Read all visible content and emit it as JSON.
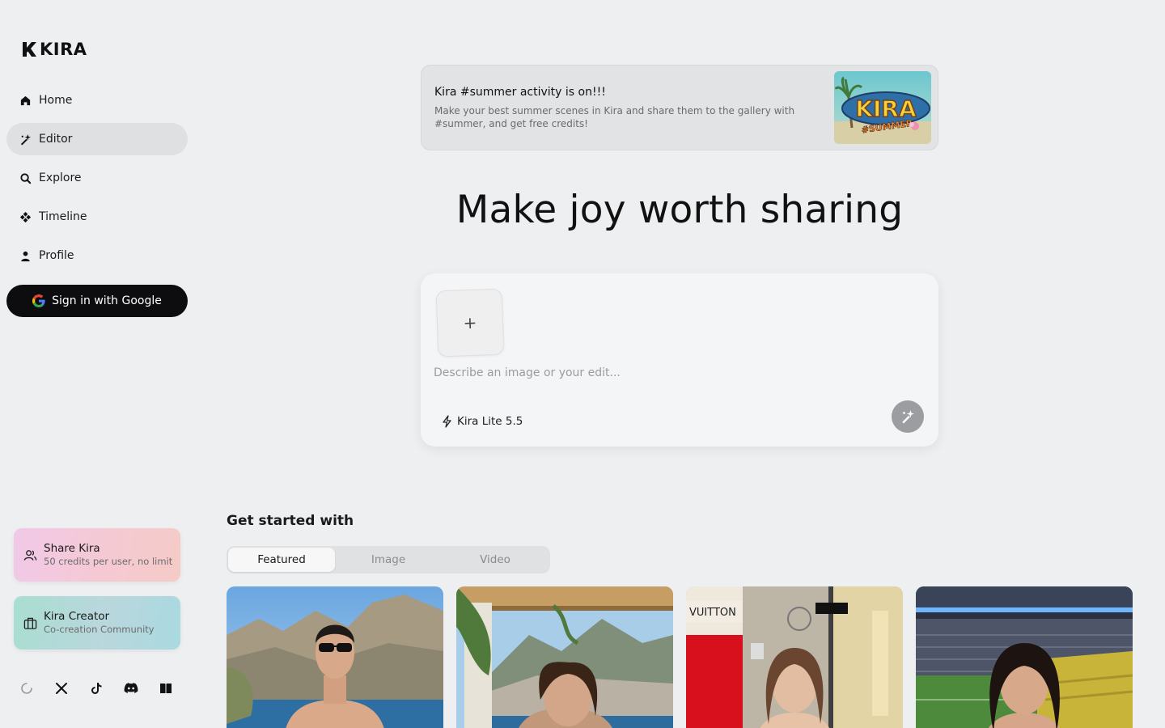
{
  "brand": {
    "name": "KIRA"
  },
  "nav": [
    {
      "key": "home",
      "label": "Home",
      "icon": "home-icon",
      "active": false
    },
    {
      "key": "editor",
      "label": "Editor",
      "icon": "sparkle-pen-icon",
      "active": true
    },
    {
      "key": "explore",
      "label": "Explore",
      "icon": "search-icon",
      "active": false
    },
    {
      "key": "timeline",
      "label": "Timeline",
      "icon": "diamond-cluster-icon",
      "active": false
    },
    {
      "key": "profile",
      "label": "Profile",
      "icon": "user-icon",
      "active": false
    }
  ],
  "auth": {
    "google_label": "Sign in with Google"
  },
  "promos": {
    "share": {
      "title": "Share Kira",
      "subtitle": "50 credits per user, no limit"
    },
    "creator": {
      "title": "Kira Creator",
      "subtitle": "Co-creation Community"
    }
  },
  "socials": [
    "loading-icon",
    "x-icon",
    "tiktok-icon",
    "discord-icon",
    "book-icon"
  ],
  "banner": {
    "title": "Kira #summer activity is on!!!",
    "description": "Make your best summer scenes in Kira and share them to the gallery with #summer, and get free credits!",
    "image_text": "KIRA",
    "image_subtext": "#SUMMER"
  },
  "hero": {
    "title": "Make joy worth sharing"
  },
  "composer": {
    "upload_symbol": "+",
    "placeholder": "Describe an image or your edit...",
    "model": "Kira Lite 5.5"
  },
  "gallery": {
    "title": "Get started with",
    "tabs": [
      {
        "label": "Featured",
        "active": true
      },
      {
        "label": "Image",
        "active": false
      },
      {
        "label": "Video",
        "active": false
      }
    ],
    "cards": [
      {
        "name": "card-man-sunglasses-coast"
      },
      {
        "name": "card-woman-terrace-coast",
        "sign": ""
      },
      {
        "name": "card-woman-vuitton-street",
        "sign": "VUITTON"
      },
      {
        "name": "card-woman-stadium"
      }
    ]
  },
  "colors": {
    "background": "#eeeff1",
    "primary_button": "#0d0d0f",
    "active_nav": "#dfe0e2",
    "generate_button": "#9c9da0"
  }
}
